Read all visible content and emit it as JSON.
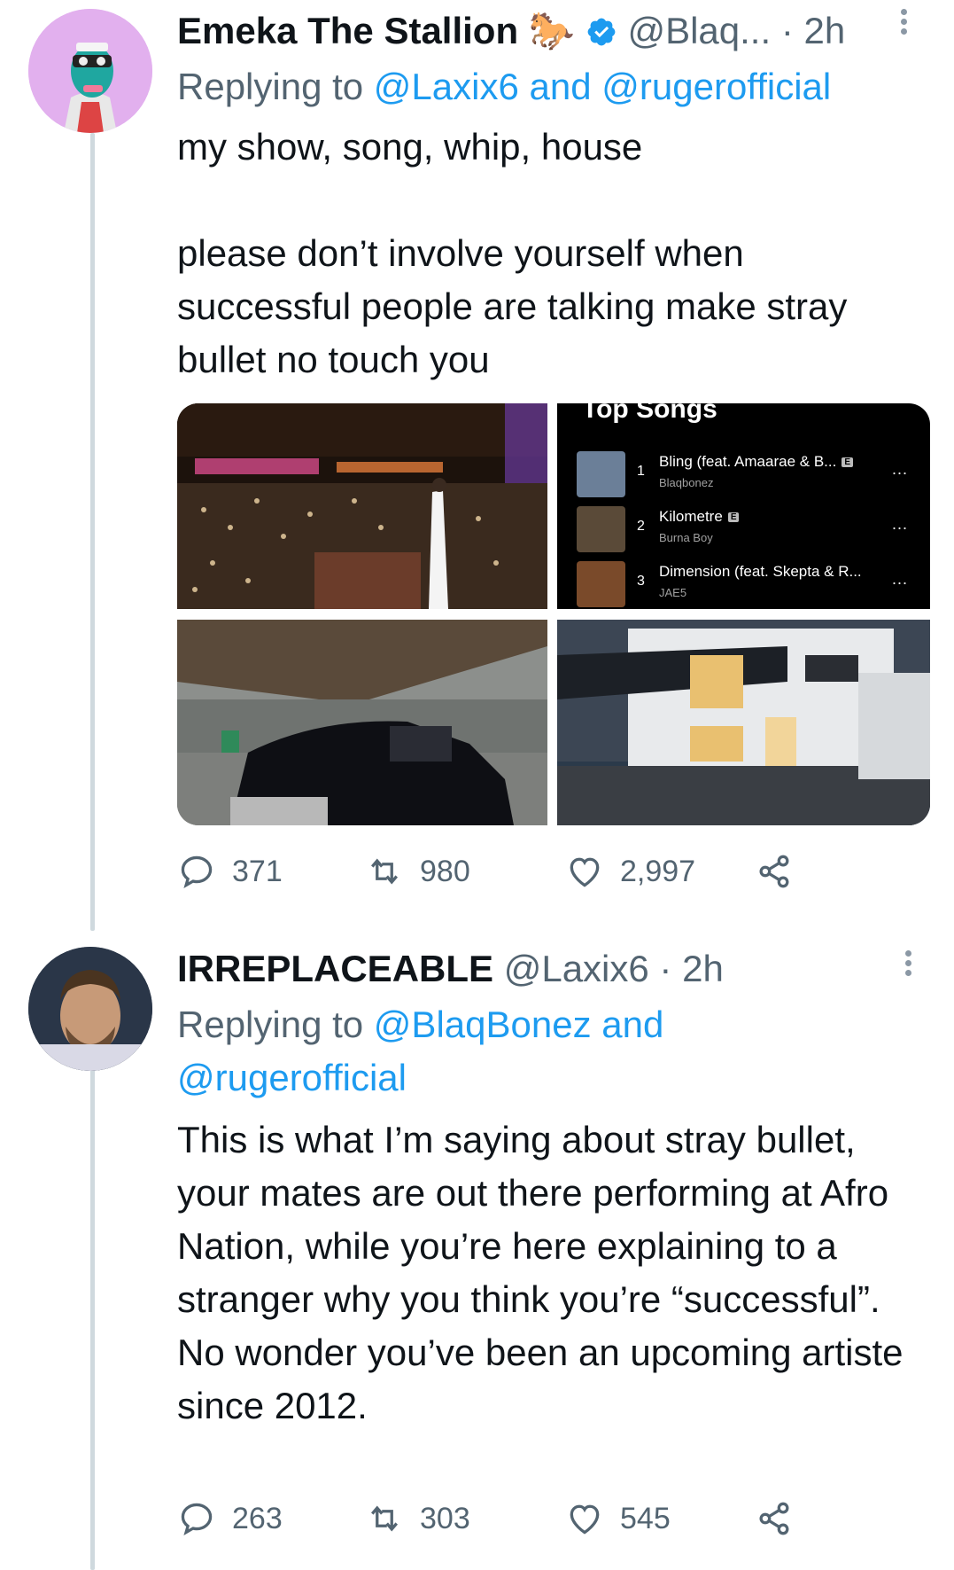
{
  "tweet1": {
    "name": "Emeka The Stallion",
    "name_emoji": "🐎",
    "handle": "@Blaq...",
    "dot": "·",
    "time": "2h",
    "reply_prefix": "Replying to",
    "reply_handle1": "@Laxix6",
    "reply_and": "and",
    "reply_handle2": "@rugerofficial",
    "text_line1": "my show, song, whip, house",
    "text_para2": "please don’t involve yourself when successful people are talking make stray bullet no touch you",
    "media": {
      "top_songs_title": "Top Songs",
      "songs": [
        {
          "num": "1",
          "title": "Bling (feat. Amaarae & B...",
          "artist": "Blaqbonez"
        },
        {
          "num": "2",
          "title": "Kilometre",
          "artist": "Burna Boy"
        },
        {
          "num": "3",
          "title": "Dimension (feat. Skepta & R...",
          "artist": "JAE5"
        }
      ],
      "explicit": "E",
      "more": "..."
    },
    "replies": "371",
    "retweets": "980",
    "likes": "2,997"
  },
  "tweet2": {
    "name": "IRREPLACEABLE",
    "handle": "@Laxix6",
    "dot": "·",
    "time": "2h",
    "reply_prefix": "Replying to",
    "reply_handle1": "@BlaqBonez",
    "reply_and": "and",
    "reply_handle2": "@rugerofficial",
    "text": "This is what I’m saying about stray bullet, your mates are out there performing at Afro Nation, while you’re here explaining to a stranger why you think you’re “successful”. No wonder you’ve been an upcoming artiste since 2012.",
    "replies": "263",
    "retweets": "303",
    "likes": "545"
  },
  "colors": {
    "link": "#1d9bf0",
    "verified": "#1d9bf0",
    "secondary": "#536471",
    "thread_line": "#cfd9de"
  },
  "icons": [
    "reply-icon",
    "retweet-icon",
    "like-icon",
    "share-icon",
    "verified-icon",
    "more-icon"
  ]
}
